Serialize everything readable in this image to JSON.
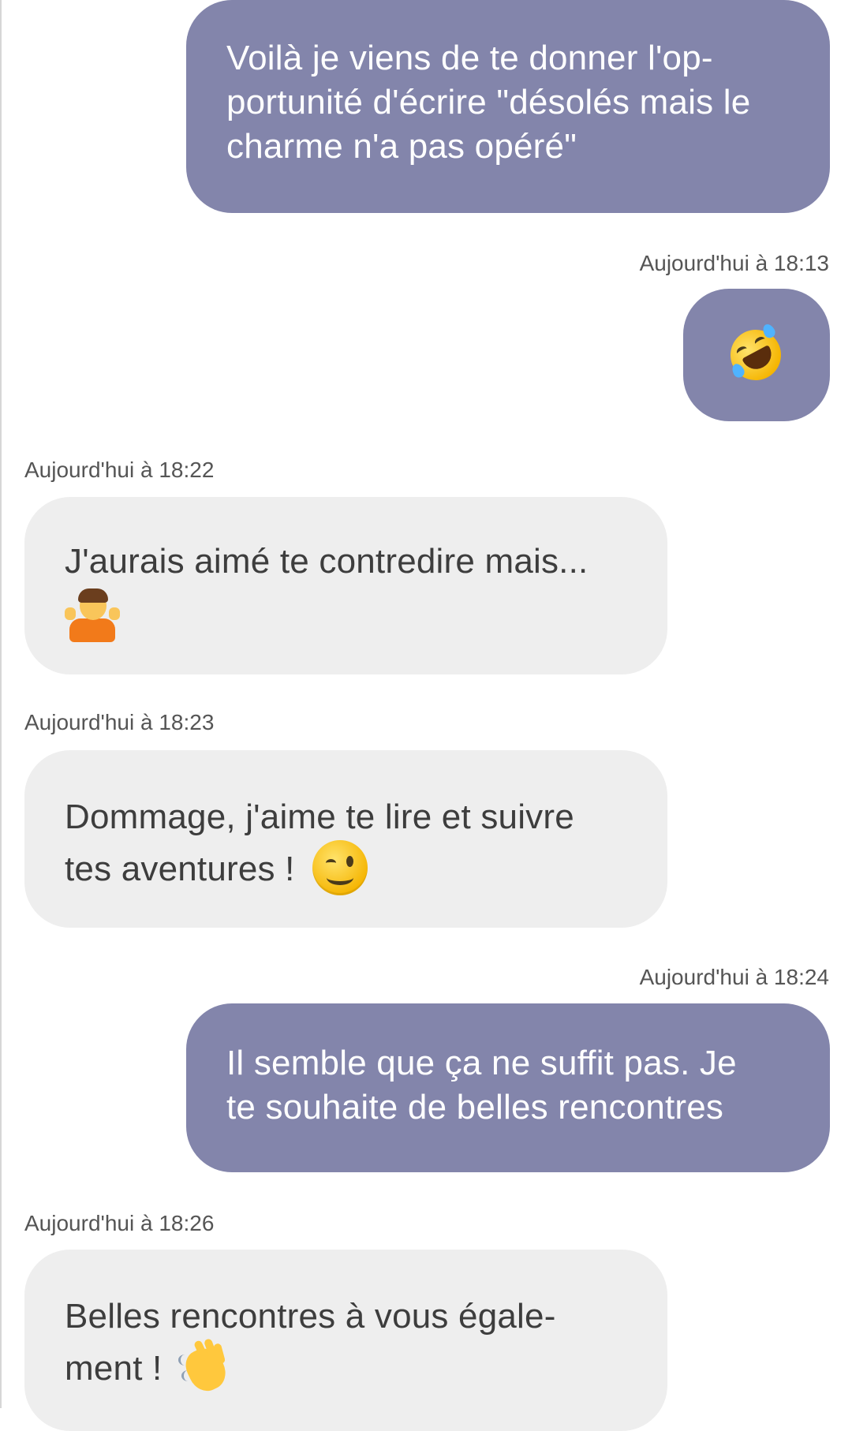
{
  "conversation": {
    "messages": [
      {
        "direction": "outgoing",
        "lines": [
          "Voilà je viens de te donner l'op-",
          "portunité d'écrire \"désolés mais le",
          "charme n'a pas opéré\""
        ]
      },
      {
        "direction": "outgoing",
        "timestamp": "Aujourd'hui à 18:13",
        "emoji": "rolling-on-floor-laughing"
      },
      {
        "direction": "incoming",
        "timestamp": "Aujourd'hui à 18:22",
        "lines": [
          "J'aurais aimé te contredire mais..."
        ],
        "emoji": "person-shrugging"
      },
      {
        "direction": "incoming",
        "timestamp": "Aujourd'hui à 18:23",
        "lines": [
          "Dommage, j'aime te lire et suivre",
          "tes aventures !"
        ],
        "emoji": "winking-face"
      },
      {
        "direction": "outgoing",
        "timestamp": "Aujourd'hui à 18:24",
        "lines": [
          "Il semble que ça ne suffit pas. Je",
          "te souhaite de belles rencontres"
        ]
      },
      {
        "direction": "incoming",
        "timestamp": "Aujourd'hui à 18:26",
        "lines": [
          "Belles rencontres à vous égale-",
          "ment !"
        ],
        "emoji": "waving-hand"
      }
    ]
  },
  "colors": {
    "outgoing_bubble": "#8385ab",
    "incoming_bubble": "#eeeeee",
    "outgoing_text": "#ffffff",
    "incoming_text": "#3d3d3d",
    "timestamp_text": "#555555"
  }
}
